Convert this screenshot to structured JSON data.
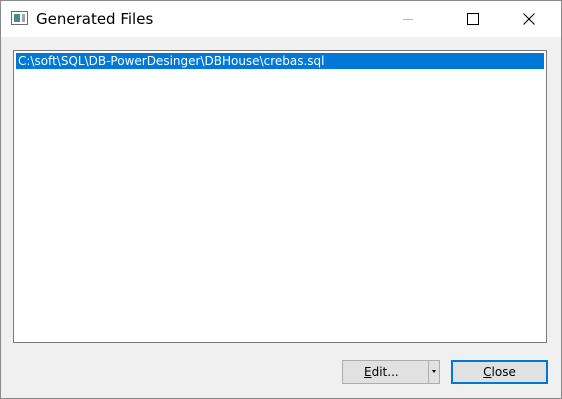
{
  "window": {
    "title": "Generated Files"
  },
  "titlebar": {
    "icon": "app-window-icon",
    "buttons": [
      "minimize-icon",
      "maximize-icon",
      "close-icon"
    ]
  },
  "file_list": {
    "items": [
      {
        "path": "C:\\soft\\SQL\\DB-PowerDesinger\\DBHouse\\crebas.sql",
        "selected": true
      }
    ]
  },
  "buttons": {
    "edit": {
      "mnemonic": "E",
      "rest": "dit..."
    },
    "close": {
      "mnemonic": "C",
      "rest": "lose"
    }
  },
  "colors": {
    "selection": "#0078d7",
    "default_button_border": "#0078d7"
  }
}
